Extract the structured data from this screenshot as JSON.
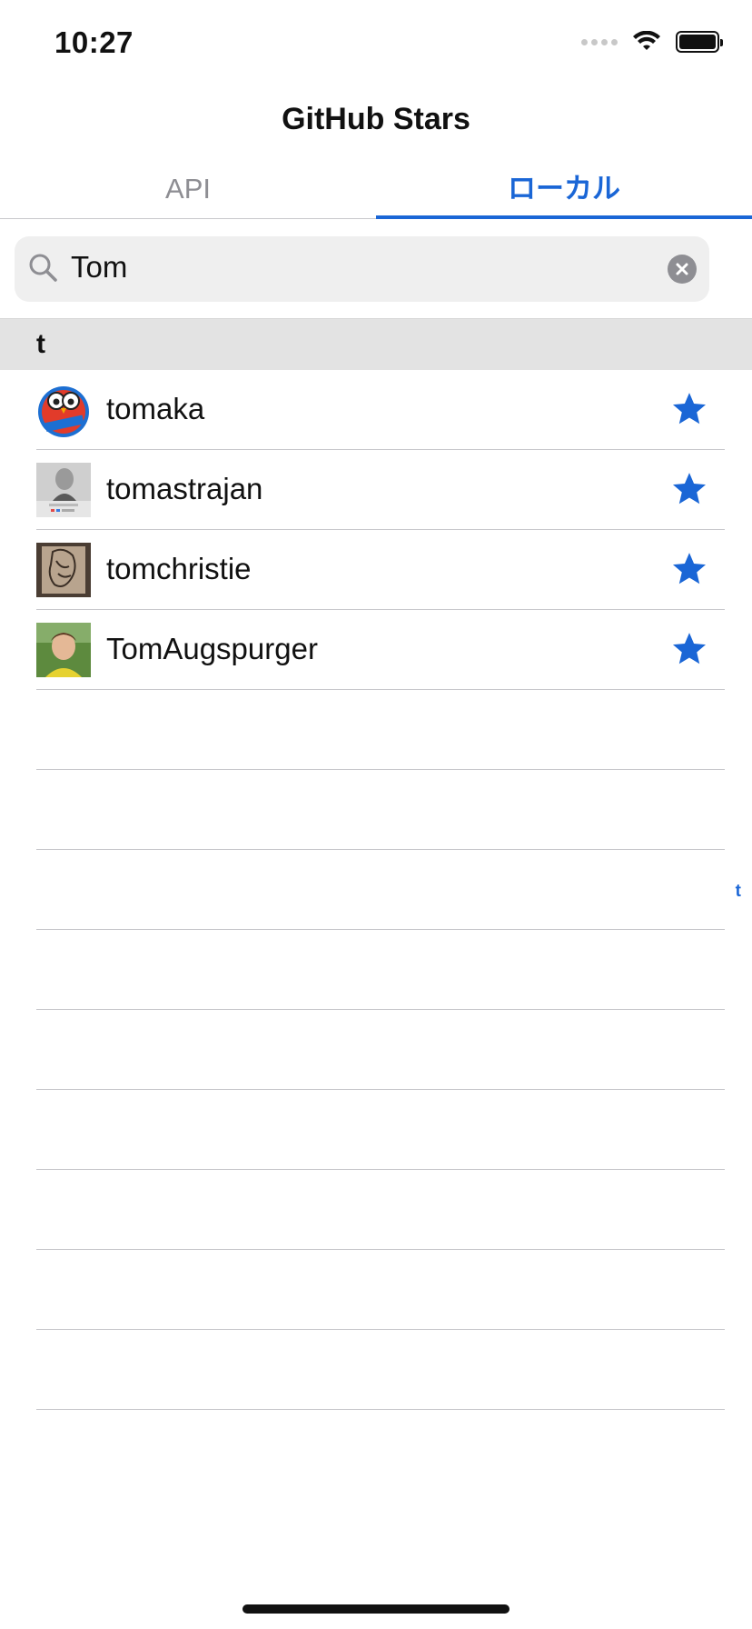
{
  "status_bar": {
    "time": "10:27"
  },
  "nav": {
    "title": "GitHub Stars"
  },
  "tabs": [
    {
      "label": "API",
      "active": false
    },
    {
      "label": "ローカル",
      "active": true
    }
  ],
  "search": {
    "value": "Tom"
  },
  "section": {
    "header": "t"
  },
  "rows": [
    {
      "name": "tomaka"
    },
    {
      "name": "tomastrajan"
    },
    {
      "name": "tomchristie"
    },
    {
      "name": "TomAugspurger"
    }
  ],
  "index": {
    "letter": "t"
  },
  "colors": {
    "accent": "#1a66d6",
    "section_bg": "#e3e3e3",
    "search_bg": "#efefef"
  }
}
